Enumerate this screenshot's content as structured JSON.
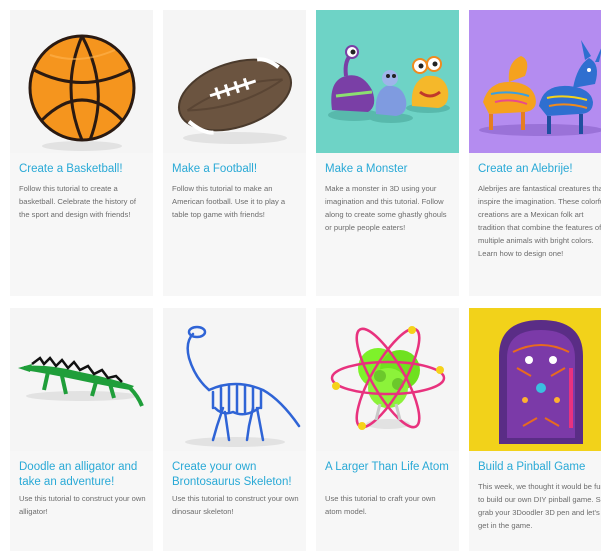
{
  "colors": {
    "title": "#29a9d6",
    "text": "#6d6d6d",
    "card_bg": "#f7f7f7",
    "monster_bg": "#6ed3c6",
    "alebrije_bg": "#b48cf0",
    "pinball_bg": "#f2d21a"
  },
  "cards": [
    {
      "title": "Create a Basketball!",
      "desc": "Follow this tutorial to create a basketball. Celebrate the history of the sport and design with friends!",
      "image": "basketball-image"
    },
    {
      "title": "Make a Football!",
      "desc": "Follow this tutorial to make an American football. Use it to play a table top game with friends!",
      "image": "football-image"
    },
    {
      "title": "Make a Monster",
      "desc": "Make a monster in 3D using your imagination and this tutorial. Follow along to create some ghastly ghouls or purple people eaters!",
      "image": "monster-image"
    },
    {
      "title": "Create an Alebrije!",
      "desc": "Alebrijes are fantastical creatures that inspire the imagination. These colorful creations are a Mexican folk art tradition that combine the features of multiple animals with bright colors. Learn how to design one!",
      "image": "alebrije-image"
    },
    {
      "title": "Doodle an alligator and take an adventure!",
      "desc": "Use this tutorial to construct your own alligator!",
      "image": "alligator-image"
    },
    {
      "title": "Create your own Brontosaurus Skeleton!",
      "desc": "Use this tutorial to construct your own dinosaur skeleton!",
      "image": "dinosaur-skeleton-image"
    },
    {
      "title": "A Larger Than Life Atom",
      "desc": "Use this tutorial to craft your own atom model.",
      "image": "atom-image"
    },
    {
      "title": "Build a Pinball Game",
      "desc": "This week, we thought it would be fun to build our own DIY pinball game. So grab your 3Doodler 3D pen and let's get in the game.",
      "image": "pinball-image"
    }
  ]
}
